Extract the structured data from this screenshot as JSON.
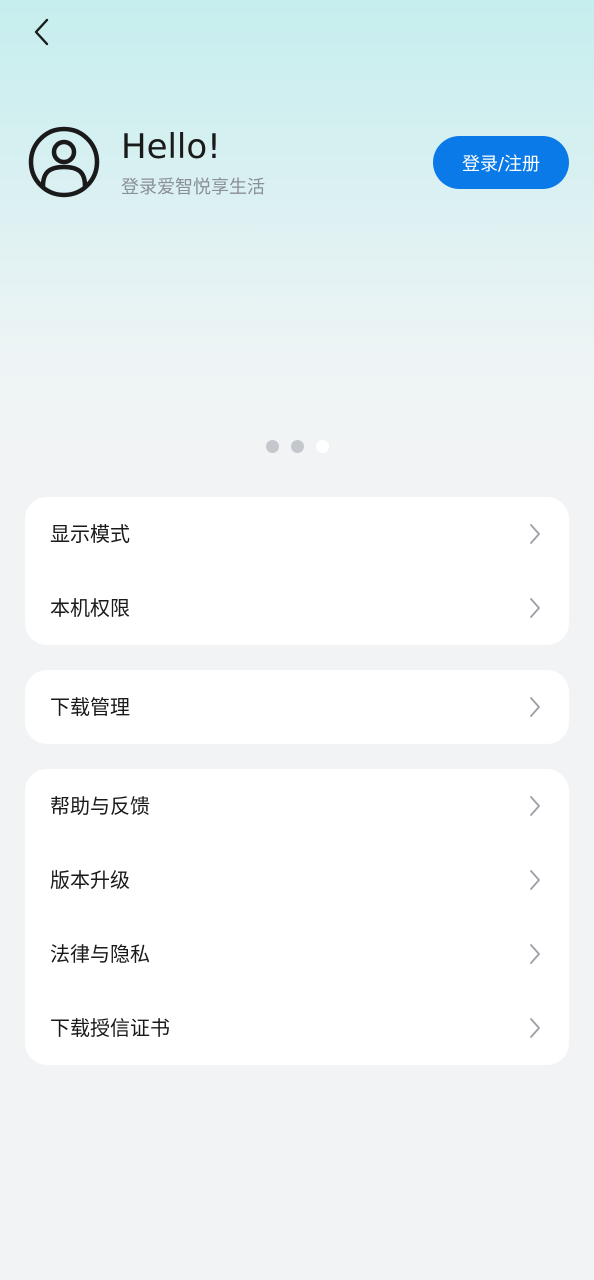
{
  "header": {
    "greeting": "Hello!",
    "subtitle": "登录爱智悦享生活",
    "login_label": "登录/注册"
  },
  "carousel": {
    "count": 3,
    "active_index": 2
  },
  "sections": [
    {
      "items": [
        {
          "label": "显示模式"
        },
        {
          "label": "本机权限"
        }
      ]
    },
    {
      "items": [
        {
          "label": "下载管理"
        }
      ]
    },
    {
      "items": [
        {
          "label": "帮助与反馈"
        },
        {
          "label": "版本升级"
        },
        {
          "label": "法律与隐私"
        },
        {
          "label": "下载授信证书"
        }
      ]
    }
  ],
  "colors": {
    "accent": "#0a7ae8",
    "page_bg": "#f2f3f5",
    "hero_top": "#c6eeee"
  }
}
